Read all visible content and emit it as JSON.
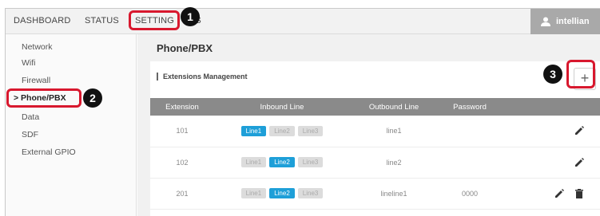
{
  "topnav": {
    "items": [
      {
        "label": "DASHBOARD"
      },
      {
        "label": "STATUS"
      },
      {
        "label": "SETTING"
      },
      {
        "label": "LS"
      }
    ],
    "user": "intellian"
  },
  "sidebar": {
    "items": [
      {
        "label": "Network"
      },
      {
        "label": "Wifi"
      },
      {
        "label": "Firewall"
      },
      {
        "label": "> Phone/PBX"
      },
      {
        "label": "Data"
      },
      {
        "label": "SDF"
      },
      {
        "label": "External GPIO"
      }
    ]
  },
  "main": {
    "title": "Phone/PBX",
    "section_title": "Extensions Management",
    "add_symbol": "+",
    "table": {
      "headers": [
        "Extension",
        "Inbound Line",
        "Outbound Line",
        "Password"
      ],
      "rows": [
        {
          "extension": "101",
          "inbound": [
            "Line1",
            "Line2",
            "Line3"
          ],
          "inbound_active": [
            true,
            false,
            false
          ],
          "outbound": "line1",
          "password": ""
        },
        {
          "extension": "102",
          "inbound": [
            "Line1",
            "Line2",
            "Line3"
          ],
          "inbound_active": [
            false,
            true,
            false
          ],
          "outbound": "line2",
          "password": ""
        },
        {
          "extension": "201",
          "inbound": [
            "Line1",
            "Line2",
            "Line3"
          ],
          "inbound_active": [
            false,
            true,
            false
          ],
          "outbound": "lineline1",
          "password": "0000"
        }
      ]
    }
  },
  "callouts": [
    "1",
    "2",
    "3"
  ],
  "colors": {
    "accent_red": "#d8182e",
    "active_line": "#1e9fd8",
    "header_gray": "#8a8a8a"
  }
}
